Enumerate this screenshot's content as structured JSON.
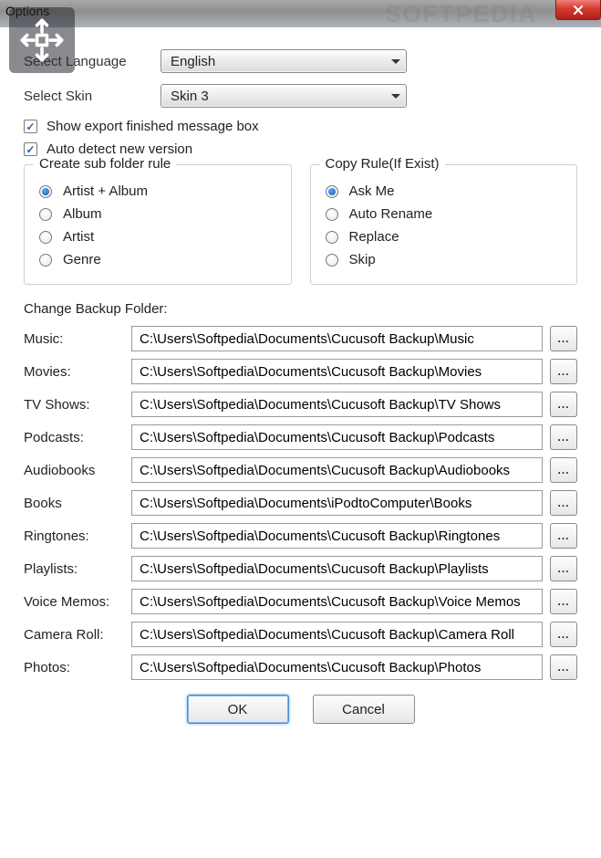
{
  "window": {
    "title": "Options",
    "watermark": "SOFTPEDIA"
  },
  "language": {
    "label": "Select Language",
    "value": "English"
  },
  "skin": {
    "label": "Select Skin",
    "value": "Skin 3"
  },
  "checkboxes": {
    "show_export_msg": "Show export finished message box",
    "auto_detect": "Auto detect new version"
  },
  "subfolder": {
    "legend": "Create sub folder rule",
    "options": [
      "Artist + Album",
      "Album",
      "Artist",
      "Genre"
    ],
    "selected": 0
  },
  "copyrule": {
    "legend": "Copy Rule(If Exist)",
    "options": [
      "Ask Me",
      "Auto Rename",
      "Replace",
      "Skip"
    ],
    "selected": 0
  },
  "backup": {
    "heading": "Change Backup Folder:",
    "rows": [
      {
        "label": "Music:",
        "path": "C:\\Users\\Softpedia\\Documents\\Cucusoft Backup\\Music"
      },
      {
        "label": "Movies:",
        "path": "C:\\Users\\Softpedia\\Documents\\Cucusoft Backup\\Movies"
      },
      {
        "label": "TV Shows:",
        "path": "C:\\Users\\Softpedia\\Documents\\Cucusoft Backup\\TV Shows"
      },
      {
        "label": "Podcasts:",
        "path": "C:\\Users\\Softpedia\\Documents\\Cucusoft Backup\\Podcasts"
      },
      {
        "label": "Audiobooks",
        "path": "C:\\Users\\Softpedia\\Documents\\Cucusoft Backup\\Audiobooks"
      },
      {
        "label": "Books",
        "path": "C:\\Users\\Softpedia\\Documents\\iPodtoComputer\\Books"
      },
      {
        "label": "Ringtones:",
        "path": "C:\\Users\\Softpedia\\Documents\\Cucusoft Backup\\Ringtones"
      },
      {
        "label": "Playlists:",
        "path": "C:\\Users\\Softpedia\\Documents\\Cucusoft Backup\\Playlists"
      },
      {
        "label": "Voice Memos:",
        "path": "C:\\Users\\Softpedia\\Documents\\Cucusoft Backup\\Voice Memos"
      },
      {
        "label": "Camera Roll:",
        "path": "C:\\Users\\Softpedia\\Documents\\Cucusoft Backup\\Camera Roll"
      },
      {
        "label": "Photos:",
        "path": "C:\\Users\\Softpedia\\Documents\\Cucusoft Backup\\Photos"
      }
    ],
    "browse_label": "..."
  },
  "buttons": {
    "ok": "OK",
    "cancel": "Cancel"
  }
}
